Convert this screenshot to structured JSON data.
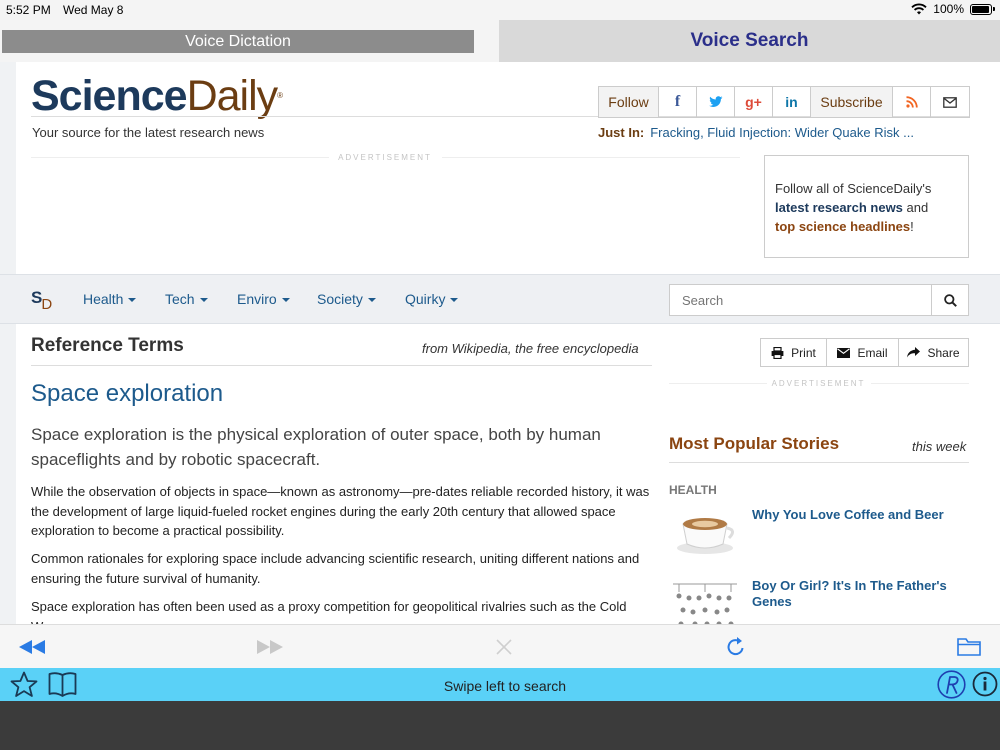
{
  "status_bar": {
    "time": "5:52 PM",
    "date": "Wed May 8",
    "battery": "100%",
    "battery_level": 1.0
  },
  "app_tabs": {
    "dictation": "Voice Dictation",
    "search": "Voice Search"
  },
  "site": {
    "logo_part1": "Science",
    "logo_part2": "Daily",
    "logo_mark": "®",
    "tagline": "Your source for the latest research news",
    "social": {
      "follow": "Follow",
      "facebook": "f",
      "twitter": "t",
      "googleplus": "g+",
      "linkedin": "in",
      "subscribe": "Subscribe"
    },
    "just_in_label": "Just In:",
    "just_in_link": "Fracking, Fluid Injection: Wider Quake Risk ...",
    "advertisement": "ADVERTISEMENT",
    "promo": {
      "line1": "Follow all of ScienceDaily's",
      "link1": "latest research news",
      "mid": " and",
      "link2": "top science headlines",
      "end": "!"
    },
    "nav": {
      "logo_s": "S",
      "logo_d": "D",
      "items": [
        "Health",
        "Tech",
        "Enviro",
        "Society",
        "Quirky"
      ],
      "search_placeholder": "Search"
    }
  },
  "article": {
    "section_title": "Reference Terms",
    "source": "from Wikipedia, the free encyclopedia",
    "title": "Space exploration",
    "lede": "Space exploration is the physical exploration of outer space, both by human spaceflights and by robotic spacecraft.",
    "paragraphs": [
      "While the observation of objects in space—known as astronomy—pre-dates reliable recorded history, it was the development of large liquid-fueled rocket engines during the early 20th century that allowed space exploration to become a practical possibility.",
      "Common rationales for exploring space include advancing scientific research, uniting different nations and ensuring the future survival of humanity.",
      "Space exploration has often been used as a proxy competition for geopolitical rivalries such as the Cold War."
    ]
  },
  "share": {
    "print": "Print",
    "email": "Email",
    "share": "Share"
  },
  "popular": {
    "title": "Most Popular Stories",
    "period": "this week",
    "category": "HEALTH",
    "stories": [
      "Why You Love Coffee and Beer",
      "Boy Or Girl? It's In The Father's Genes"
    ]
  },
  "bottom_bar": {
    "hint": "Swipe left to search"
  },
  "colors": {
    "accent_brown": "#8b4511",
    "link_blue": "#1d5a8c",
    "bar_cyan": "#5ad1f7",
    "tab_purple": "#2b2f8a"
  }
}
